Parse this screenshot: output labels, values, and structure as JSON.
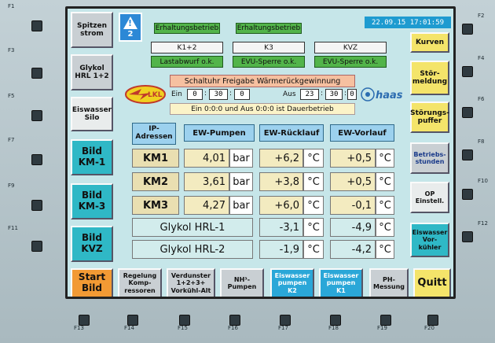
{
  "function_keys": {
    "left": [
      "F1",
      "F3",
      "F5",
      "F7",
      "F9",
      "F11"
    ],
    "right": [
      "F2",
      "F4",
      "F6",
      "F8",
      "F10",
      "F12"
    ],
    "bottom": [
      "F13",
      "F14",
      "F15",
      "F16",
      "F17",
      "F18",
      "F19",
      "F20"
    ]
  },
  "left_buttons": [
    {
      "label": "Spitzen\nstrom"
    },
    {
      "label": "Glykol\nHRL 1+2"
    },
    {
      "label": "Eiswasser\nSilo"
    },
    {
      "label": "Bild\nKM-1"
    },
    {
      "label": "Bild\nKM-3"
    },
    {
      "label": "Bild\nKVZ"
    }
  ],
  "start_button": "Start\nBild",
  "warning": {
    "count": "2"
  },
  "status": {
    "col1": {
      "title": "Erhaltungsbetrieb",
      "name": "K1+2",
      "state": "Lastabwurf o.k."
    },
    "col2": {
      "title": "Erhaltungsbetrieb",
      "name": "K3",
      "state": "EVU-Sperre o.k."
    },
    "col3": {
      "title": "",
      "name": "KVZ",
      "state": "EVU-Sperre o.k."
    }
  },
  "clock": "22.09.15 17:01:59",
  "timer": {
    "title": "Schaltuhr Freigabe Wärmerückgewinnung",
    "ein_label": "Ein",
    "ein": [
      "0",
      "30",
      "0"
    ],
    "aus_label": "Aus",
    "aus": [
      "23",
      "30",
      "0"
    ],
    "note": "Ein 0:0:0 und Aus 0:0:0 ist Dauerbetrieb"
  },
  "logos": {
    "left": "LKL",
    "right": "haas"
  },
  "table": {
    "headers": [
      "IP-\nAdressen",
      "EW-Pumpen",
      "EW-Rücklauf",
      "EW-Vorlauf"
    ],
    "rows": [
      {
        "name": "KM1",
        "pumpe": "4,01",
        "p_unit": "bar",
        "ruecklauf": "+6,2",
        "r_unit": "°C",
        "vorlauf": "+0,5",
        "v_unit": "°C"
      },
      {
        "name": "KM2",
        "pumpe": "3,61",
        "p_unit": "bar",
        "ruecklauf": "+3,8",
        "r_unit": "°C",
        "vorlauf": "+0,5",
        "v_unit": "°C"
      },
      {
        "name": "KM3",
        "pumpe": "4,27",
        "p_unit": "bar",
        "ruecklauf": "+6,0",
        "r_unit": "°C",
        "vorlauf": "-0,1",
        "v_unit": "°C"
      },
      {
        "name": "Glykol HRL-1",
        "ruecklauf": "-3,1",
        "r_unit": "°C",
        "vorlauf": "-4,9",
        "v_unit": "°C"
      },
      {
        "name": "Glykol HRL-2",
        "ruecklauf": "-1,9",
        "r_unit": "°C",
        "vorlauf": "-4,2",
        "v_unit": "°C"
      }
    ]
  },
  "right_buttons": [
    {
      "label": "Kurven"
    },
    {
      "label": "Stör-\nmeldung"
    },
    {
      "label": "Störungs-\npuffer"
    },
    {
      "label": "Betriebs-\nstunden"
    },
    {
      "label": "OP\nEinstell."
    },
    {
      "label": "Eiswasser\nVor-\nkühler"
    }
  ],
  "bottom_buttons": [
    {
      "label": "Regelung\nKomp-\nressoren"
    },
    {
      "label": "Verdunster\n1+2+3+\nVorkühl-Alt"
    },
    {
      "label": "NH³-\nPumpen"
    },
    {
      "label": "Eiswasser\npumpen\nK2"
    },
    {
      "label": "Eiswasser\npumpen\nK1"
    },
    {
      "label": "PH-\nMessung"
    }
  ],
  "quit_button": "Quitt",
  "colors": {
    "screen_bg": "#c6e6e9",
    "accent_blue": "#1e9bd0",
    "green": "#52b44a"
  }
}
